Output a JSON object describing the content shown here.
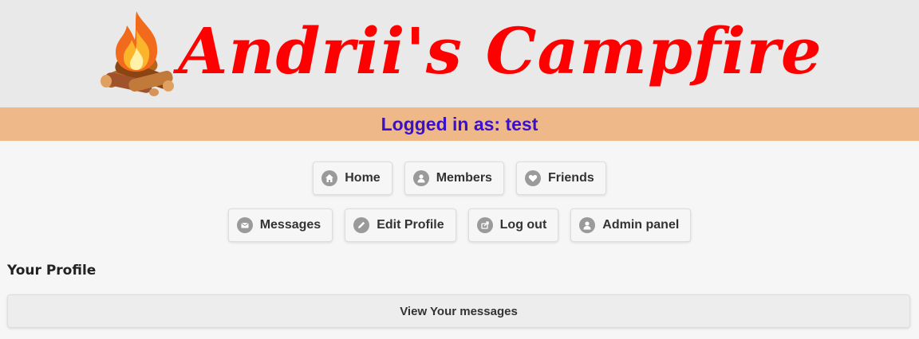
{
  "header": {
    "logo_icon": "campfire-icon",
    "title": "Andrii's Campfire",
    "title_color": "#ff0000",
    "background": "#e9e9e9"
  },
  "status": {
    "text": "Logged in as: test",
    "bar_color": "#eeb888",
    "text_color": "#3a10d0"
  },
  "nav": {
    "row1": [
      {
        "label": "Home",
        "icon": "home-icon"
      },
      {
        "label": "Members",
        "icon": "user-icon"
      },
      {
        "label": "Friends",
        "icon": "heart-icon"
      }
    ],
    "row2": [
      {
        "label": "Messages",
        "icon": "mail-icon"
      },
      {
        "label": "Edit Profile",
        "icon": "edit-icon"
      },
      {
        "label": "Log out",
        "icon": "logout-icon"
      },
      {
        "label": "Admin panel",
        "icon": "user-icon"
      }
    ]
  },
  "profile": {
    "heading": "Your Profile",
    "view_messages_label": "View Your messages"
  }
}
